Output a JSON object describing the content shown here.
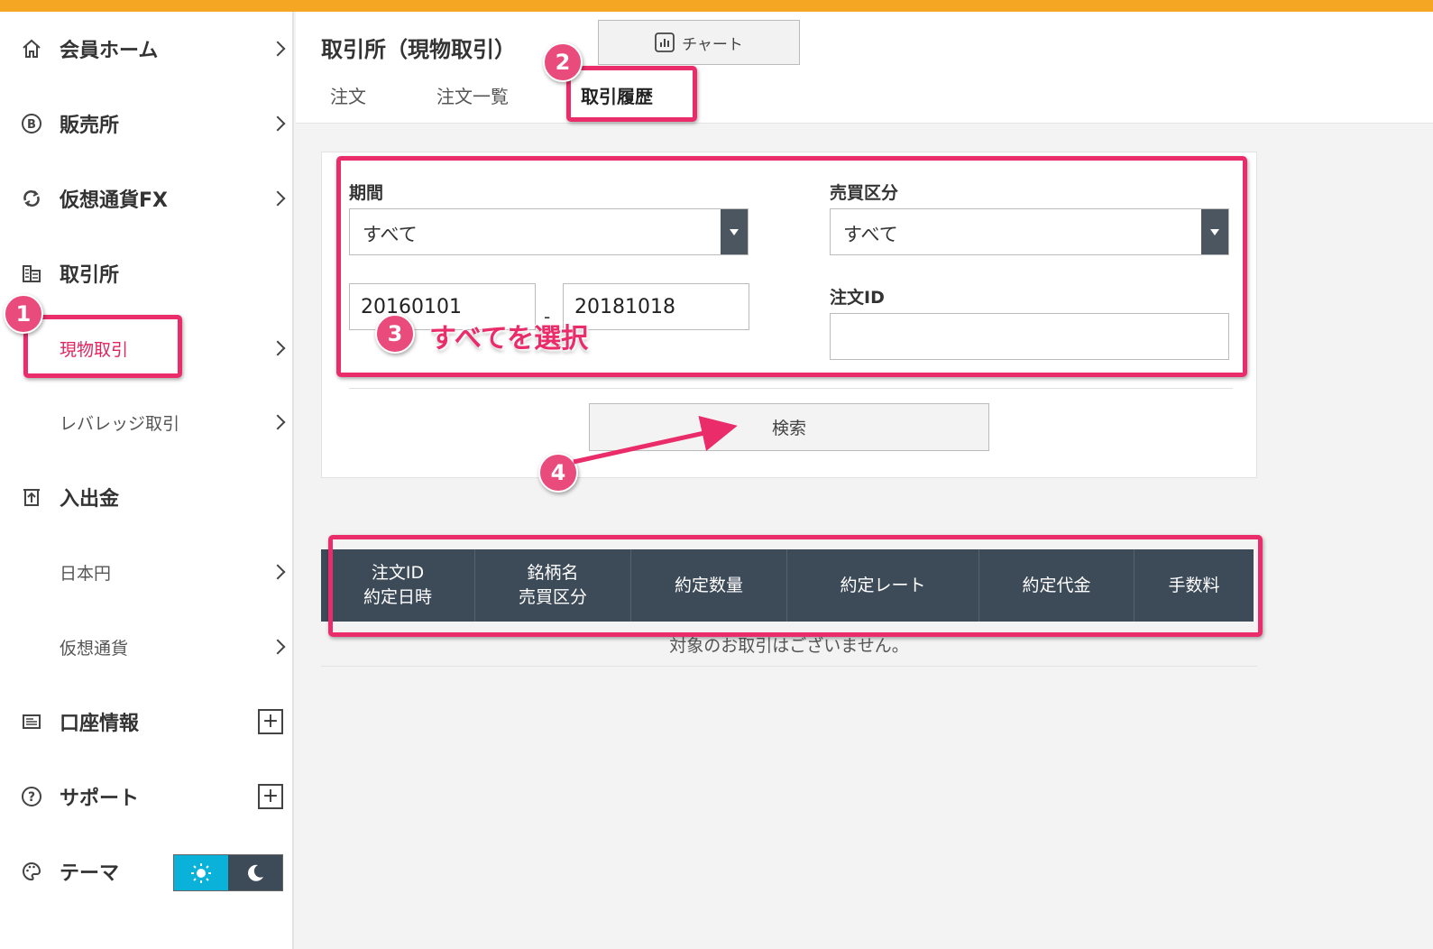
{
  "sidebar": {
    "items": [
      {
        "label": "会員ホーム"
      },
      {
        "label": "販売所"
      },
      {
        "label": "仮想通貨FX"
      },
      {
        "label": "取引所"
      },
      {
        "label": "現物取引"
      },
      {
        "label": "レバレッジ取引"
      },
      {
        "label": "入出金"
      },
      {
        "label": "日本円"
      },
      {
        "label": "仮想通貨"
      },
      {
        "label": "口座情報"
      },
      {
        "label": "サポート"
      },
      {
        "label": "テーマ"
      }
    ]
  },
  "header": {
    "title": "取引所（現物取引）",
    "chart_button": "チャート",
    "tabs": [
      {
        "label": "注文"
      },
      {
        "label": "注文一覧"
      },
      {
        "label": "取引履歴"
      }
    ]
  },
  "search": {
    "period_label": "期間",
    "period_value": "すべて",
    "side_label": "売買区分",
    "side_value": "すべて",
    "date_from": "20160101",
    "date_sep": "-",
    "date_to": "20181018",
    "order_id_label": "注文ID",
    "order_id_value": "",
    "search_button": "検索"
  },
  "table": {
    "headers": [
      {
        "line1": "注文ID",
        "line2": "約定日時"
      },
      {
        "line1": "銘柄名",
        "line2": "売買区分"
      },
      {
        "line1": "約定数量",
        "line2": ""
      },
      {
        "line1": "約定レート",
        "line2": ""
      },
      {
        "line1": "約定代金",
        "line2": ""
      },
      {
        "line1": "手数料",
        "line2": ""
      }
    ],
    "empty_message": "対象のお取引はございません。"
  },
  "annotations": {
    "badges": [
      "1",
      "2",
      "3",
      "4"
    ],
    "note": "すべてを選択",
    "color": "#ea2c6a"
  },
  "colors": {
    "accent": "#f5a623",
    "table_header": "#3d4a58",
    "active_item": "#e0245e"
  }
}
